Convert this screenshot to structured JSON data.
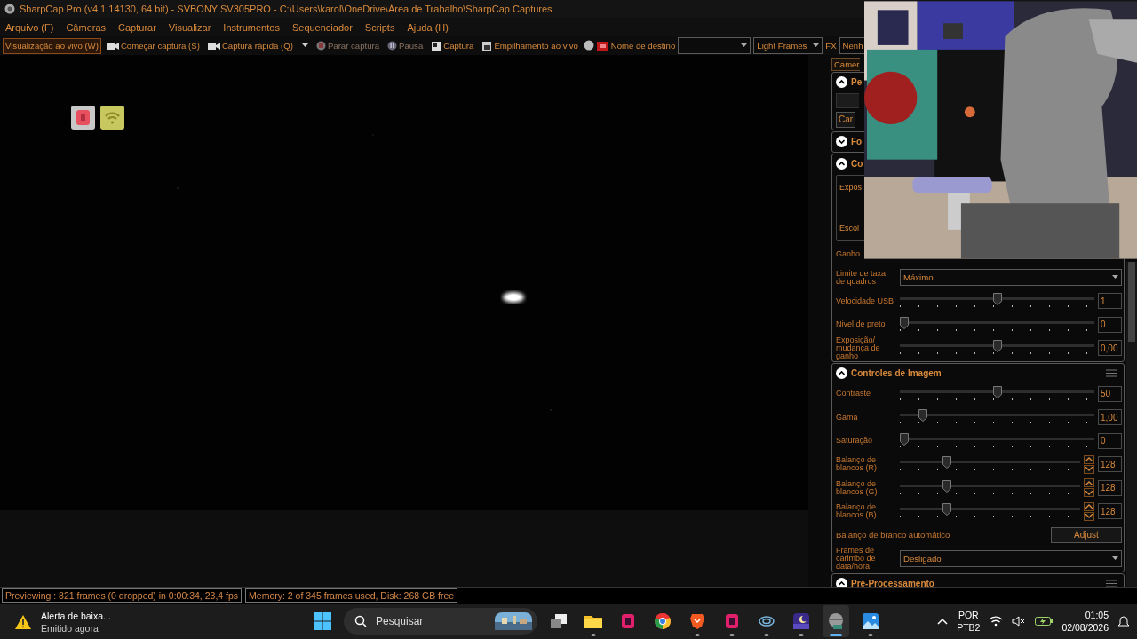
{
  "window": {
    "title": "SharpCap Pro (v4.1.14130, 64 bit) - SVBONY SV305PRO - C:\\Users\\karol\\OneDrive\\Área de Trabalho\\SharpCap Captures"
  },
  "menu": [
    "Arquivo (F)",
    "Câmeras",
    "Capturar",
    "Visualizar",
    "Instrumentos",
    "Sequenciador",
    "Scripts",
    "Ajuda (H)"
  ],
  "toolbar": {
    "items": [
      {
        "kind": "toggle",
        "label": "Visualização ao vivo (W)",
        "selected": true
      },
      {
        "kind": "button",
        "label": "Começar captura (S)",
        "disabled": false
      },
      {
        "kind": "split",
        "label": "Captura rápida (Q)",
        "disabled": false
      },
      {
        "kind": "button",
        "label": "Parar captura",
        "disabled": true
      },
      {
        "kind": "button",
        "label": "Pausa",
        "disabled": true
      },
      {
        "kind": "button",
        "label": "Captura",
        "disabled": false
      },
      {
        "kind": "button",
        "label": "Empilhamento ao vivo",
        "disabled": false
      },
      {
        "kind": "icon"
      },
      {
        "kind": "label",
        "label": "Nome de destino"
      }
    ],
    "frame_type": "Light Frames",
    "fx_label": "FX",
    "fx_select": "Nenh"
  },
  "panel": {
    "tab": "Camer",
    "sections": [
      {
        "title": "Pe",
        "expanded": true,
        "rows": [
          {
            "kind": "field"
          },
          {
            "kind": "button",
            "label": "Car"
          }
        ]
      },
      {
        "title": "Fo",
        "expanded": false
      },
      {
        "title": "Co",
        "expanded": true,
        "rows": [
          {
            "kind": "group",
            "lines": [
              "Expos",
              "Escol"
            ]
          },
          {
            "kind": "text",
            "label": "Ganho"
          },
          {
            "kind": "select",
            "label": "Limite de taxa de quadros",
            "value": "Máximo"
          },
          {
            "kind": "slider",
            "label": "Velocidade USB",
            "level": 0.5,
            "value": "1"
          },
          {
            "kind": "slider",
            "label": "Nivel de preto",
            "level": 0,
            "value": "0"
          },
          {
            "kind": "slider",
            "label": "Exposição/ mudança de ganho",
            "level": 0.5,
            "value": "0,00"
          }
        ]
      },
      {
        "title": "Controles de Imagem",
        "expanded": true,
        "menu": true,
        "rows": [
          {
            "kind": "slider",
            "label": "Contraste",
            "level": 0.5,
            "value": "50"
          },
          {
            "kind": "slider",
            "label": "Gama",
            "level": 0.1,
            "value": "1,00"
          },
          {
            "kind": "slider",
            "label": "Saturação",
            "level": 0,
            "value": "0"
          },
          {
            "kind": "spin-slider",
            "label": "Balanço de blancos (R)",
            "level": 0.25,
            "value": "128"
          },
          {
            "kind": "spin-slider",
            "label": "Balanço de blancos (G)",
            "level": 0.25,
            "value": "128"
          },
          {
            "kind": "spin-slider",
            "label": "Balanço de blancos (B)",
            "level": 0.25,
            "value": "128"
          },
          {
            "kind": "action",
            "label": "Balanço de branco automático",
            "button": "Adjust"
          },
          {
            "kind": "select",
            "label": "Frames de carimbo de data/hora",
            "value": "Desligado"
          }
        ]
      },
      {
        "title": "Pré-Processamento",
        "expanded": true,
        "menu": true
      }
    ]
  },
  "status_bar": [
    "Previewing : 821 frames (0 dropped) in 0:00:34, 23,4 fps",
    "Memory: 2 of 345 frames used, Disk: 268 GB free"
  ],
  "taskbar": {
    "notification": {
      "title": "Alerta de baixa...",
      "subtitle": "Emitido agora"
    },
    "search": {
      "placeholder": "Pesquisar"
    },
    "apps": [
      {
        "running": false,
        "selected": false
      },
      {
        "running": true,
        "selected": false
      },
      {
        "running": false,
        "selected": false
      },
      {
        "running": false,
        "selected": false
      },
      {
        "running": true,
        "selected": false
      },
      {
        "running": true,
        "selected": false
      },
      {
        "running": true,
        "selected": false
      },
      {
        "running": true,
        "selected": false
      },
      {
        "running": true,
        "selected": true
      },
      {
        "running": true,
        "selected": false
      }
    ],
    "tray": {
      "language": "POR",
      "layout": "PTB2",
      "time": "01:05",
      "date": "02/08/2026"
    }
  }
}
